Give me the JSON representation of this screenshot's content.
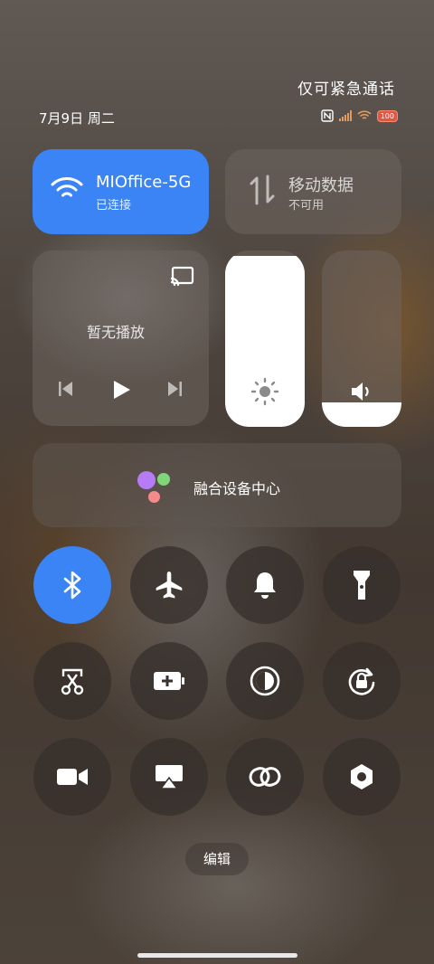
{
  "status_bar": {
    "emergency_text": "仅可紧急通话",
    "date": "7月9日 周二",
    "battery": "100"
  },
  "wifi_tile": {
    "title": "MIOffice-5G",
    "subtitle": "已连接",
    "active": true,
    "color": "#3a84f5"
  },
  "data_tile": {
    "title": "移动数据",
    "subtitle": "不可用",
    "active": false
  },
  "media": {
    "empty_text": "暂无播放"
  },
  "brightness": {
    "level": 0.97
  },
  "volume": {
    "level": 0.14
  },
  "device_hub": {
    "label": "融合设备中心"
  },
  "toggles": [
    {
      "name": "bluetooth",
      "icon": "bluetooth-icon",
      "on": true
    },
    {
      "name": "airplane-mode",
      "icon": "airplane-icon",
      "on": false
    },
    {
      "name": "ringer",
      "icon": "bell-icon",
      "on": false
    },
    {
      "name": "flashlight",
      "icon": "flashlight-icon",
      "on": false
    },
    {
      "name": "screenshot",
      "icon": "scissors-icon",
      "on": false
    },
    {
      "name": "battery-saver",
      "icon": "battery-plus-icon",
      "on": false
    },
    {
      "name": "dark-mode",
      "icon": "contrast-icon",
      "on": false
    },
    {
      "name": "rotation-lock",
      "icon": "rotation-lock-icon",
      "on": false
    },
    {
      "name": "screen-record",
      "icon": "video-camera-icon",
      "on": false
    },
    {
      "name": "screen-cast",
      "icon": "airplay-icon",
      "on": false
    },
    {
      "name": "link-share",
      "icon": "link-icon",
      "on": false
    },
    {
      "name": "settings",
      "icon": "hexagon-settings-icon",
      "on": false
    }
  ],
  "edit_label": "编辑",
  "accent_color": "#3a84f5"
}
